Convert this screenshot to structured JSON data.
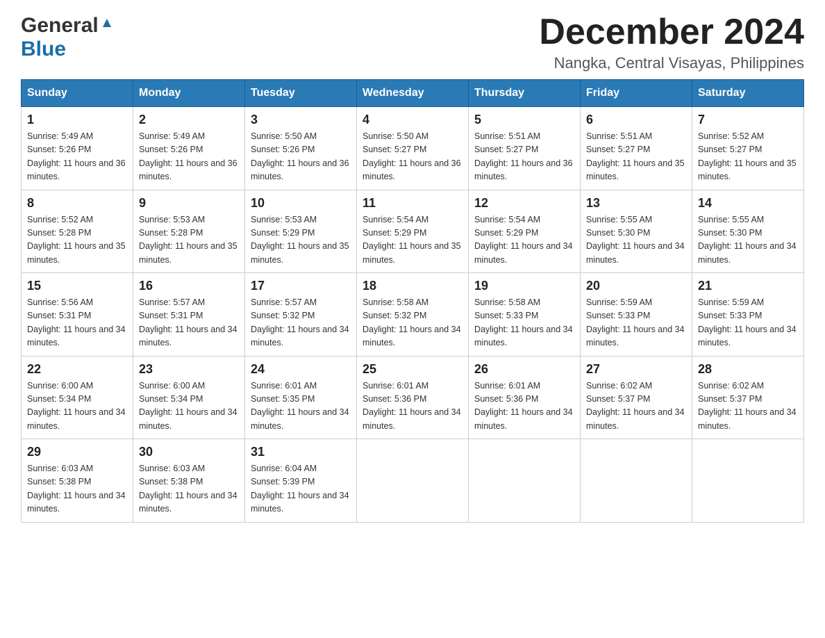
{
  "header": {
    "logo_general": "General",
    "logo_blue": "Blue",
    "month_year": "December 2024",
    "location": "Nangka, Central Visayas, Philippines"
  },
  "days_of_week": [
    "Sunday",
    "Monday",
    "Tuesday",
    "Wednesday",
    "Thursday",
    "Friday",
    "Saturday"
  ],
  "weeks": [
    [
      {
        "day": "1",
        "sunrise": "Sunrise: 5:49 AM",
        "sunset": "Sunset: 5:26 PM",
        "daylight": "Daylight: 11 hours and 36 minutes."
      },
      {
        "day": "2",
        "sunrise": "Sunrise: 5:49 AM",
        "sunset": "Sunset: 5:26 PM",
        "daylight": "Daylight: 11 hours and 36 minutes."
      },
      {
        "day": "3",
        "sunrise": "Sunrise: 5:50 AM",
        "sunset": "Sunset: 5:26 PM",
        "daylight": "Daylight: 11 hours and 36 minutes."
      },
      {
        "day": "4",
        "sunrise": "Sunrise: 5:50 AM",
        "sunset": "Sunset: 5:27 PM",
        "daylight": "Daylight: 11 hours and 36 minutes."
      },
      {
        "day": "5",
        "sunrise": "Sunrise: 5:51 AM",
        "sunset": "Sunset: 5:27 PM",
        "daylight": "Daylight: 11 hours and 36 minutes."
      },
      {
        "day": "6",
        "sunrise": "Sunrise: 5:51 AM",
        "sunset": "Sunset: 5:27 PM",
        "daylight": "Daylight: 11 hours and 35 minutes."
      },
      {
        "day": "7",
        "sunrise": "Sunrise: 5:52 AM",
        "sunset": "Sunset: 5:27 PM",
        "daylight": "Daylight: 11 hours and 35 minutes."
      }
    ],
    [
      {
        "day": "8",
        "sunrise": "Sunrise: 5:52 AM",
        "sunset": "Sunset: 5:28 PM",
        "daylight": "Daylight: 11 hours and 35 minutes."
      },
      {
        "day": "9",
        "sunrise": "Sunrise: 5:53 AM",
        "sunset": "Sunset: 5:28 PM",
        "daylight": "Daylight: 11 hours and 35 minutes."
      },
      {
        "day": "10",
        "sunrise": "Sunrise: 5:53 AM",
        "sunset": "Sunset: 5:29 PM",
        "daylight": "Daylight: 11 hours and 35 minutes."
      },
      {
        "day": "11",
        "sunrise": "Sunrise: 5:54 AM",
        "sunset": "Sunset: 5:29 PM",
        "daylight": "Daylight: 11 hours and 35 minutes."
      },
      {
        "day": "12",
        "sunrise": "Sunrise: 5:54 AM",
        "sunset": "Sunset: 5:29 PM",
        "daylight": "Daylight: 11 hours and 34 minutes."
      },
      {
        "day": "13",
        "sunrise": "Sunrise: 5:55 AM",
        "sunset": "Sunset: 5:30 PM",
        "daylight": "Daylight: 11 hours and 34 minutes."
      },
      {
        "day": "14",
        "sunrise": "Sunrise: 5:55 AM",
        "sunset": "Sunset: 5:30 PM",
        "daylight": "Daylight: 11 hours and 34 minutes."
      }
    ],
    [
      {
        "day": "15",
        "sunrise": "Sunrise: 5:56 AM",
        "sunset": "Sunset: 5:31 PM",
        "daylight": "Daylight: 11 hours and 34 minutes."
      },
      {
        "day": "16",
        "sunrise": "Sunrise: 5:57 AM",
        "sunset": "Sunset: 5:31 PM",
        "daylight": "Daylight: 11 hours and 34 minutes."
      },
      {
        "day": "17",
        "sunrise": "Sunrise: 5:57 AM",
        "sunset": "Sunset: 5:32 PM",
        "daylight": "Daylight: 11 hours and 34 minutes."
      },
      {
        "day": "18",
        "sunrise": "Sunrise: 5:58 AM",
        "sunset": "Sunset: 5:32 PM",
        "daylight": "Daylight: 11 hours and 34 minutes."
      },
      {
        "day": "19",
        "sunrise": "Sunrise: 5:58 AM",
        "sunset": "Sunset: 5:33 PM",
        "daylight": "Daylight: 11 hours and 34 minutes."
      },
      {
        "day": "20",
        "sunrise": "Sunrise: 5:59 AM",
        "sunset": "Sunset: 5:33 PM",
        "daylight": "Daylight: 11 hours and 34 minutes."
      },
      {
        "day": "21",
        "sunrise": "Sunrise: 5:59 AM",
        "sunset": "Sunset: 5:33 PM",
        "daylight": "Daylight: 11 hours and 34 minutes."
      }
    ],
    [
      {
        "day": "22",
        "sunrise": "Sunrise: 6:00 AM",
        "sunset": "Sunset: 5:34 PM",
        "daylight": "Daylight: 11 hours and 34 minutes."
      },
      {
        "day": "23",
        "sunrise": "Sunrise: 6:00 AM",
        "sunset": "Sunset: 5:34 PM",
        "daylight": "Daylight: 11 hours and 34 minutes."
      },
      {
        "day": "24",
        "sunrise": "Sunrise: 6:01 AM",
        "sunset": "Sunset: 5:35 PM",
        "daylight": "Daylight: 11 hours and 34 minutes."
      },
      {
        "day": "25",
        "sunrise": "Sunrise: 6:01 AM",
        "sunset": "Sunset: 5:36 PM",
        "daylight": "Daylight: 11 hours and 34 minutes."
      },
      {
        "day": "26",
        "sunrise": "Sunrise: 6:01 AM",
        "sunset": "Sunset: 5:36 PM",
        "daylight": "Daylight: 11 hours and 34 minutes."
      },
      {
        "day": "27",
        "sunrise": "Sunrise: 6:02 AM",
        "sunset": "Sunset: 5:37 PM",
        "daylight": "Daylight: 11 hours and 34 minutes."
      },
      {
        "day": "28",
        "sunrise": "Sunrise: 6:02 AM",
        "sunset": "Sunset: 5:37 PM",
        "daylight": "Daylight: 11 hours and 34 minutes."
      }
    ],
    [
      {
        "day": "29",
        "sunrise": "Sunrise: 6:03 AM",
        "sunset": "Sunset: 5:38 PM",
        "daylight": "Daylight: 11 hours and 34 minutes."
      },
      {
        "day": "30",
        "sunrise": "Sunrise: 6:03 AM",
        "sunset": "Sunset: 5:38 PM",
        "daylight": "Daylight: 11 hours and 34 minutes."
      },
      {
        "day": "31",
        "sunrise": "Sunrise: 6:04 AM",
        "sunset": "Sunset: 5:39 PM",
        "daylight": "Daylight: 11 hours and 34 minutes."
      },
      null,
      null,
      null,
      null
    ]
  ]
}
